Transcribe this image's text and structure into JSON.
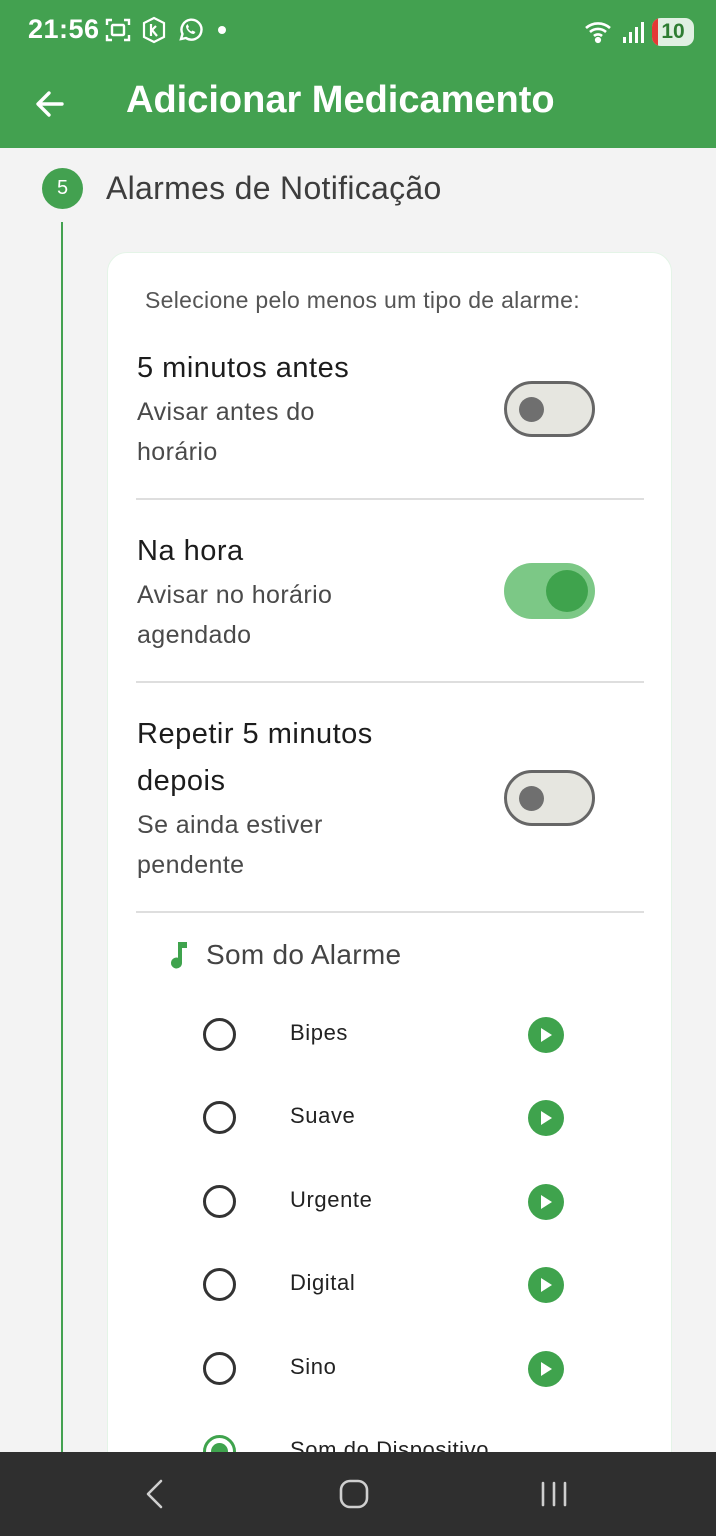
{
  "status_bar": {
    "time": "21:56",
    "battery": "10",
    "icons_left": [
      "screenshot-icon",
      "k-shield-icon",
      "whatsapp-icon",
      "notification-dot-icon"
    ],
    "icons_right": [
      "wifi-icon",
      "signal-icon",
      "battery-icon"
    ]
  },
  "app_bar": {
    "title": "Adicionar Medicamento",
    "back_icon": "arrow-left-icon"
  },
  "step": {
    "number": "5",
    "title": "Alarmes de Notificação"
  },
  "card": {
    "hint": "Selecione pelo menos um tipo de alarme:",
    "options": [
      {
        "title": "5 minutos antes",
        "subtitle_line1": "Avisar antes do",
        "subtitle_line2": "horário",
        "enabled": false
      },
      {
        "title": "Na hora",
        "subtitle_line1": "Avisar no horário",
        "subtitle_line2": "agendado",
        "enabled": true
      },
      {
        "title_line1": "Repetir 5 minutos",
        "title_line2": "depois",
        "subtitle_line1": "Se ainda estiver",
        "subtitle_line2": "pendente",
        "enabled": false
      }
    ],
    "sound_section": {
      "icon": "music-note-icon",
      "title": "Som do Alarme",
      "sounds": [
        {
          "label": "Bipes",
          "selected": false
        },
        {
          "label": "Suave",
          "selected": false
        },
        {
          "label": "Urgente",
          "selected": false
        },
        {
          "label": "Digital",
          "selected": false
        },
        {
          "label": "Sino",
          "selected": false
        },
        {
          "label": "Som do Dispositivo",
          "selected": true
        }
      ]
    }
  },
  "nav_bar": {
    "buttons": [
      "back-nav-icon",
      "home-nav-icon",
      "recents-nav-icon"
    ]
  },
  "colors": {
    "primary": "#43a150",
    "toggle_on_track": "#7cc886",
    "toggle_on_knob": "#3fa34d",
    "nav_bar": "#2f2f2f"
  }
}
